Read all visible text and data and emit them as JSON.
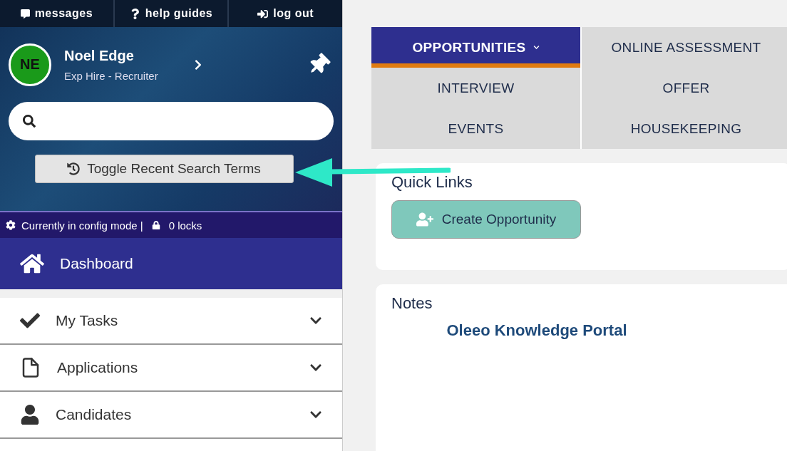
{
  "top_bar": [
    {
      "kind": "messages",
      "label": "messages"
    },
    {
      "kind": "help",
      "label": "help guides"
    },
    {
      "kind": "logout",
      "label": "log out"
    }
  ],
  "profile": {
    "initials": "NE",
    "name": "Noel Edge",
    "role": "Exp Hire - Recruiter"
  },
  "recent_toggle": {
    "label": "Toggle Recent Search Terms"
  },
  "config_bar": {
    "mode": "Currently in config mode |",
    "locks": "0 locks"
  },
  "nav": [
    {
      "kind": "home",
      "label": "Dashboard",
      "selected": true
    },
    {
      "kind": "tasks",
      "label": "My Tasks",
      "selected": false
    },
    {
      "kind": "applications",
      "label": "Applications",
      "selected": false
    },
    {
      "kind": "candidates",
      "label": "Candidates",
      "selected": false
    }
  ],
  "tabs": [
    {
      "label": "OPPORTUNITIES",
      "selected": true,
      "dropdown": true
    },
    {
      "label": "ONLINE ASSESSMENT",
      "selected": false,
      "dropdown": false
    },
    {
      "label": "INTERVIEW",
      "selected": false,
      "dropdown": false
    },
    {
      "label": "OFFER",
      "selected": false,
      "dropdown": false
    },
    {
      "label": "EVENTS",
      "selected": false,
      "dropdown": false
    },
    {
      "label": "HOUSEKEEPING",
      "selected": false,
      "dropdown": false
    }
  ],
  "quick_links": {
    "title": "Quick Links",
    "buttons": [
      "Create Opportunity"
    ]
  },
  "notes": {
    "title": "Notes",
    "links": [
      "Oleeo Knowledge Portal"
    ]
  }
}
